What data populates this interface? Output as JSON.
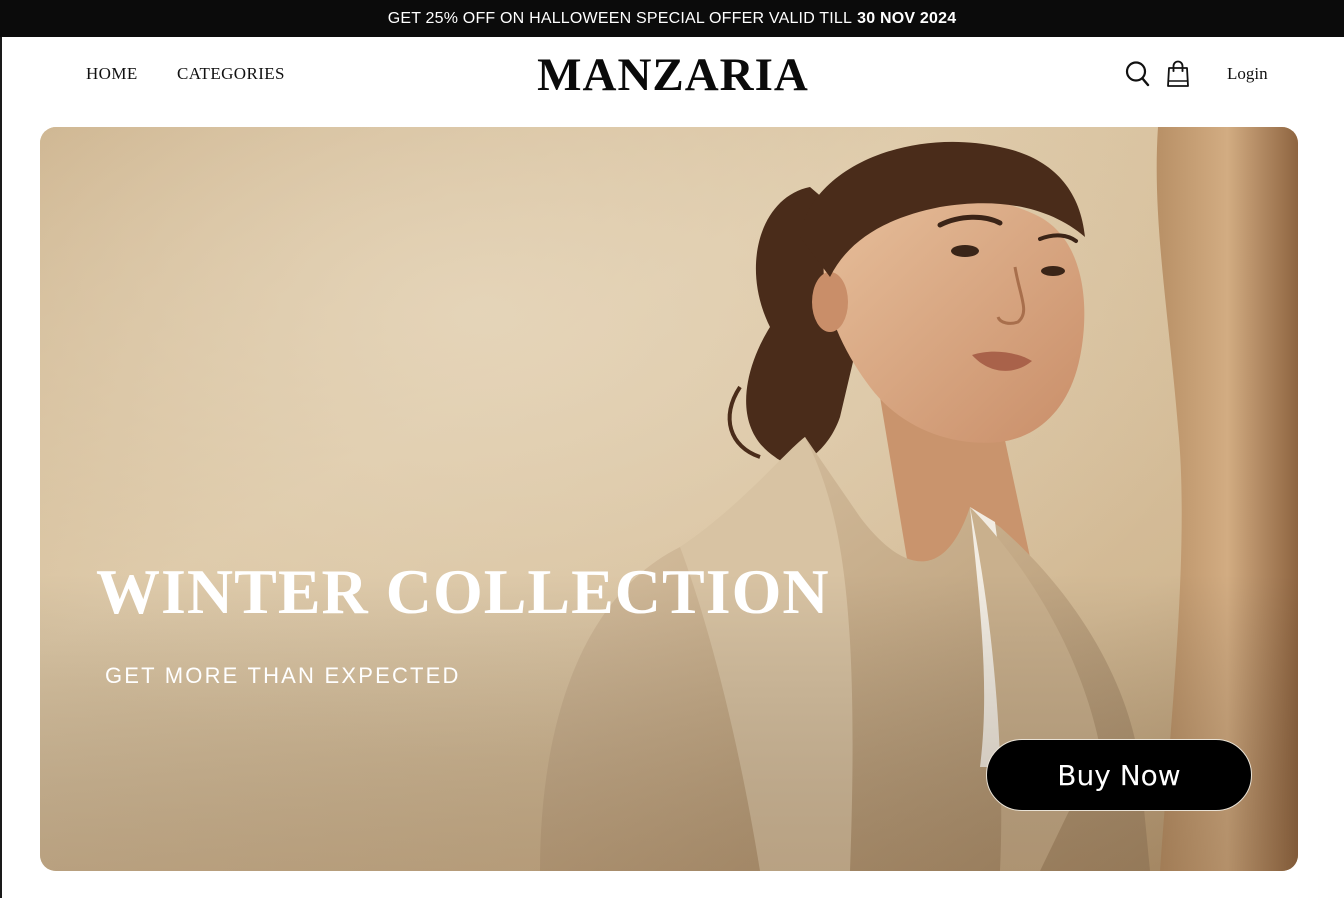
{
  "promo": {
    "text": "GET 25% OFF ON HALLOWEEN SPECIAL OFFER VALID TILL",
    "date": "30 NOV 2024"
  },
  "nav": {
    "home": "HOME",
    "categories": "CATEGORIES",
    "login": "Login"
  },
  "brand": {
    "logo": "MANZARIA"
  },
  "icons": {
    "search": "search-icon",
    "bag": "shopping-bag-icon"
  },
  "hero": {
    "title": "WINTER COLLECTION",
    "subtitle": "GET MORE THAN EXPECTED",
    "cta": "Buy Now",
    "background_color": "#d7c1a1"
  },
  "colors": {
    "promo_bg": "#0b0b0b",
    "cta_bg": "#000000",
    "text_dark": "#111111"
  }
}
